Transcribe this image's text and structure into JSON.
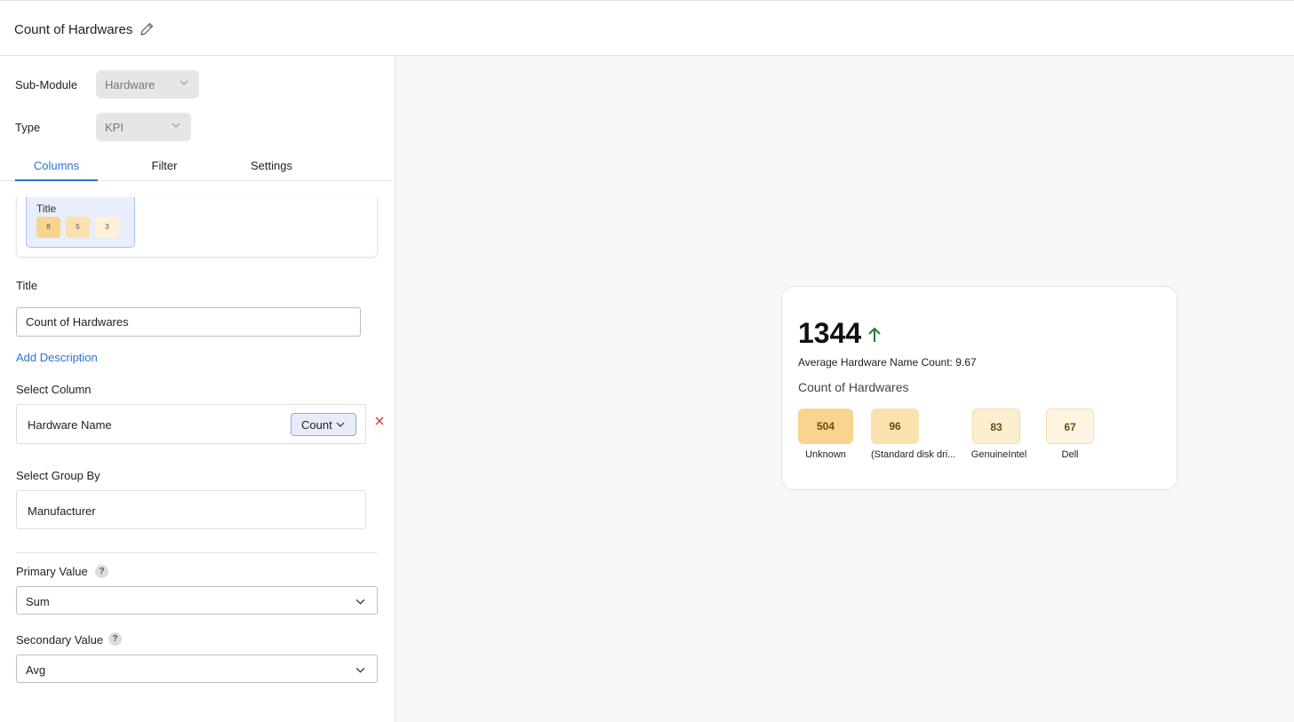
{
  "header": {
    "title": "Count of Hardwares"
  },
  "form": {
    "submodule_label": "Sub-Module",
    "submodule_value": "Hardware",
    "type_label": "Type",
    "type_value": "KPI",
    "tabs": [
      {
        "label": "Columns",
        "active": true
      },
      {
        "label": "Filter",
        "active": false
      },
      {
        "label": "Settings",
        "active": false
      }
    ],
    "preview": {
      "title": "Title",
      "values": [
        "8",
        "5",
        "3"
      ]
    },
    "title_label": "Title",
    "title_value": "Count of Hardwares",
    "add_description": "Add Description",
    "select_column_label": "Select Column",
    "column_name": "Hardware Name",
    "aggregate": "Count",
    "group_by_label": "Select Group By",
    "group_by_value": "Manufacturer",
    "primary_label": "Primary Value",
    "primary_value": "Sum",
    "secondary_label": "Secondary Value",
    "secondary_value": "Avg",
    "help_glyph": "?"
  },
  "kpi": {
    "value": "1344",
    "trend": "up",
    "secondary_text": "Average Hardware Name Count: 9.67",
    "title": "Count of Hardwares",
    "groups": [
      {
        "value": "504",
        "label": "Unknown"
      },
      {
        "value": "96",
        "label": "(Standard disk dri..."
      },
      {
        "value": "83",
        "label": "GenuineIntel"
      },
      {
        "value": "67",
        "label": "Dell"
      }
    ]
  },
  "colors": {
    "accent": "#2e6fd8",
    "trend_up": "#1e7a32",
    "chip_1": "#f8d48e",
    "chip_2": "#fbe1ae",
    "chip_3": "#fdeed0",
    "chip_4": "#fef4e1",
    "remove": "#d23b3b"
  }
}
